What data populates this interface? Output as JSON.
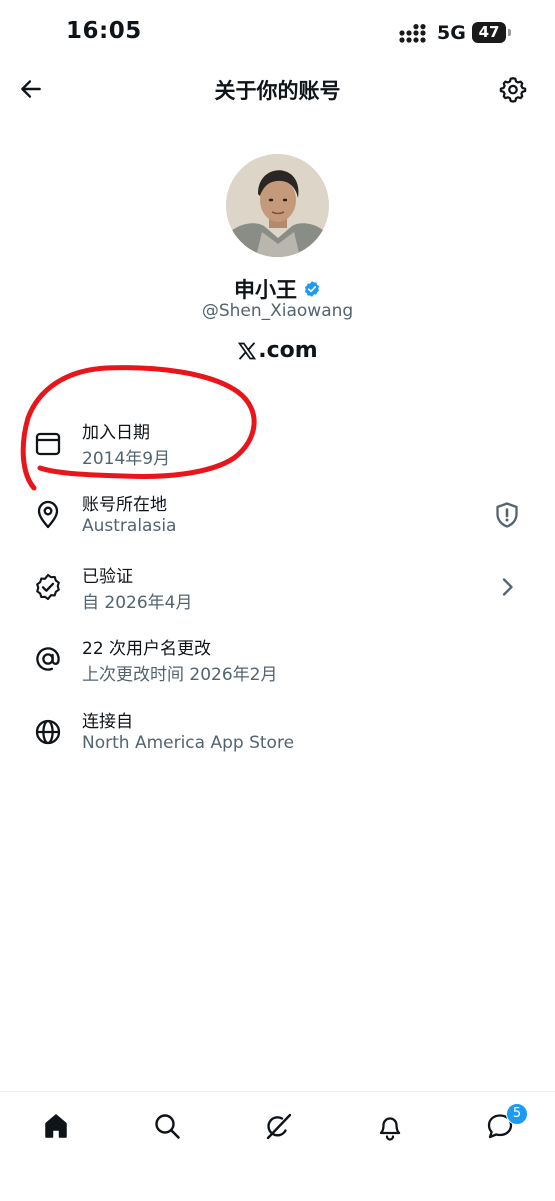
{
  "status_bar": {
    "time": "16:05",
    "network": "5G",
    "battery": "47"
  },
  "header": {
    "title": "关于你的账号"
  },
  "profile": {
    "name": "申小王",
    "handle": "@Shen_Xiaowang",
    "brand_suffix": ".com"
  },
  "info": [
    {
      "icon": "calendar-icon",
      "title": "加入日期",
      "sub": "2014年9月"
    },
    {
      "icon": "location-pin-icon",
      "title": "账号所在地",
      "sub": "Australasia",
      "trailing": "shield-alert-icon"
    },
    {
      "icon": "verified-check-icon",
      "title": "已验证",
      "sub": "自 2026年4月",
      "trailing": "chevron-right-icon"
    },
    {
      "icon": "at-sign-icon",
      "title": "22 次用户名更改",
      "sub": "上次更改时间 2026年2月"
    },
    {
      "icon": "globe-icon",
      "title": "连接自",
      "sub": "North America App Store"
    }
  ],
  "bottom_nav": {
    "items": [
      "home-icon",
      "search-icon",
      "grok-icon",
      "notifications-icon",
      "messages-icon"
    ],
    "messages_badge": "5"
  },
  "colors": {
    "text_primary": "#0f1419",
    "text_secondary": "#536471",
    "accent": "#1d9bf0",
    "annotation": "#e8161b"
  }
}
